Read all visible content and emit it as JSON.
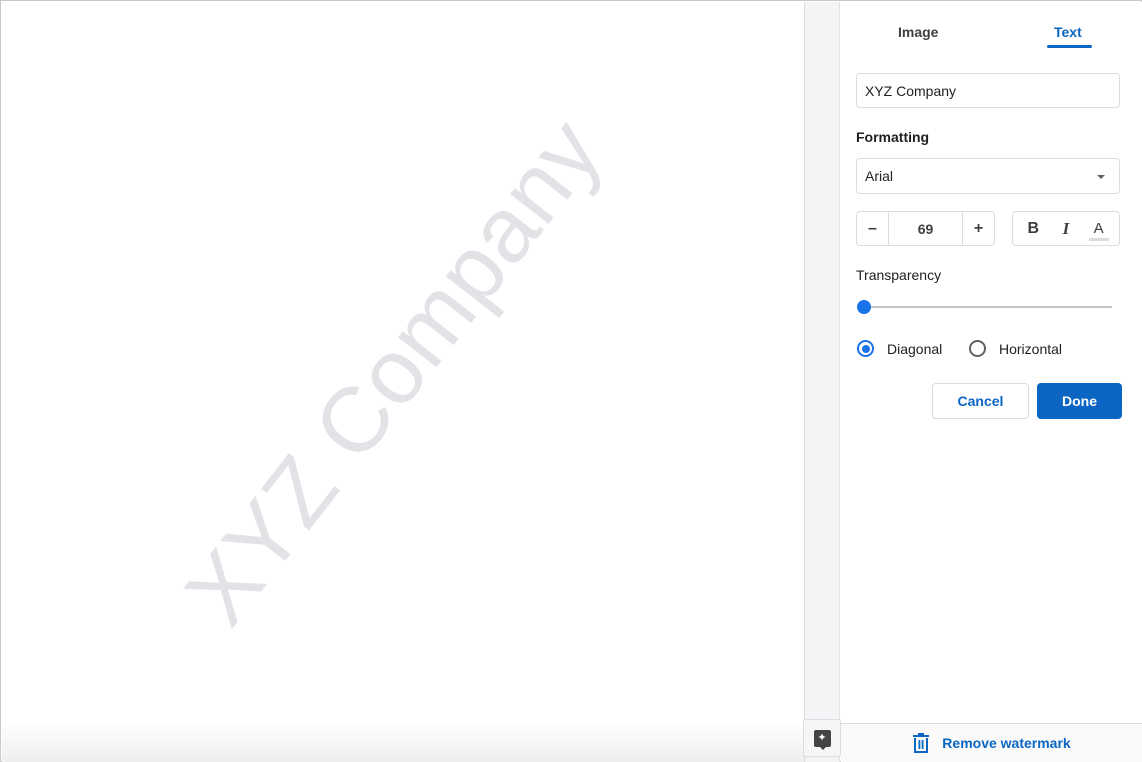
{
  "document": {
    "watermark_text": "XYZ Company",
    "watermark_color": "#e1e3e6"
  },
  "panel": {
    "tabs": [
      {
        "label": "Image",
        "active": false
      },
      {
        "label": "Text",
        "active": true
      }
    ],
    "text_value": "XYZ Company",
    "formatting_label": "Formatting",
    "font": "Arial",
    "font_size": "69",
    "decrement_label": "–",
    "increment_label": "+",
    "bold_label": "B",
    "italic_label": "I",
    "color_label": "A",
    "transparency_label": "Transparency",
    "transparency_value_percent": 0,
    "orientation": {
      "options": [
        {
          "label": "Diagonal",
          "checked": true
        },
        {
          "label": "Horizontal",
          "checked": false
        }
      ]
    },
    "cancel_label": "Cancel",
    "done_label": "Done",
    "remove_label": "Remove watermark"
  },
  "colors": {
    "accent": "#0b66c3",
    "slider_thumb": "#1a73e8"
  }
}
